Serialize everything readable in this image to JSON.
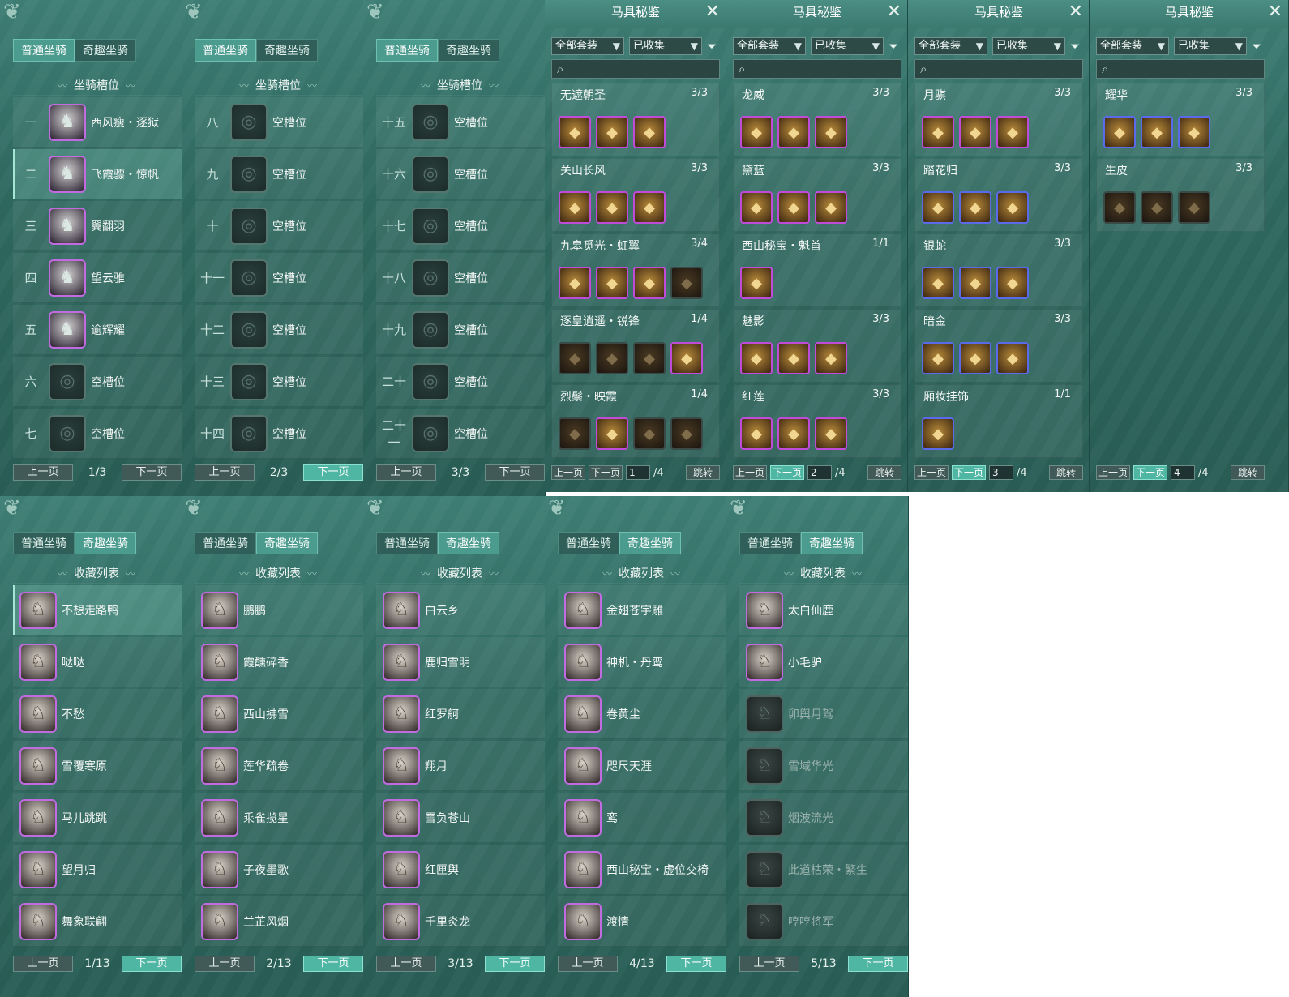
{
  "colors": {
    "panel_bg": "#2f6960",
    "tab_active": "#4b9c8e",
    "highlight_button": "#4fb6a4",
    "rarity_purple": "#c04bd8",
    "rarity_blue": "#5a6ae8"
  },
  "mount_tabs": [
    "普通坐骑",
    "奇趣坐骑"
  ],
  "slots_title": "坐骑槽位",
  "collection_title": "收藏列表",
  "prev_label": "上一页",
  "next_label": "下一页",
  "slot_panels": [
    {
      "page": "1/3",
      "slots": [
        {
          "num": "一",
          "name": "西风瘦・逐狱",
          "filled": true,
          "selected": false
        },
        {
          "num": "二",
          "name": "飞霞骠・惊帆",
          "filled": true,
          "selected": true
        },
        {
          "num": "三",
          "name": "翼翻羽",
          "filled": true,
          "selected": false
        },
        {
          "num": "四",
          "name": "望云骓",
          "filled": true,
          "selected": false
        },
        {
          "num": "五",
          "name": "逾辉耀",
          "filled": true,
          "selected": false
        },
        {
          "num": "六",
          "name": "空槽位",
          "filled": false,
          "selected": false
        },
        {
          "num": "七",
          "name": "空槽位",
          "filled": false,
          "selected": false
        }
      ]
    },
    {
      "page": "2/3",
      "slots": [
        {
          "num": "八",
          "name": "空槽位",
          "filled": false,
          "selected": false
        },
        {
          "num": "九",
          "name": "空槽位",
          "filled": false,
          "selected": false
        },
        {
          "num": "十",
          "name": "空槽位",
          "filled": false,
          "selected": false
        },
        {
          "num": "十一",
          "name": "空槽位",
          "filled": false,
          "selected": false
        },
        {
          "num": "十二",
          "name": "空槽位",
          "filled": false,
          "selected": false
        },
        {
          "num": "十三",
          "name": "空槽位",
          "filled": false,
          "selected": false
        },
        {
          "num": "十四",
          "name": "空槽位",
          "filled": false,
          "selected": false
        }
      ]
    },
    {
      "page": "3/3",
      "slots": [
        {
          "num": "十五",
          "name": "空槽位",
          "filled": false,
          "selected": false
        },
        {
          "num": "十六",
          "name": "空槽位",
          "filled": false,
          "selected": false
        },
        {
          "num": "十七",
          "name": "空槽位",
          "filled": false,
          "selected": false
        },
        {
          "num": "十八",
          "name": "空槽位",
          "filled": false,
          "selected": false
        },
        {
          "num": "十九",
          "name": "空槽位",
          "filled": false,
          "selected": false
        },
        {
          "num": "二十",
          "name": "空槽位",
          "filled": false,
          "selected": false
        },
        {
          "num": "二十一",
          "name": "空槽位",
          "filled": false,
          "selected": false
        }
      ]
    }
  ],
  "harness": {
    "title": "马具秘鉴",
    "filter_set": "全部套装",
    "filter_status": "已收集",
    "prev_short": "上一页",
    "next_short": "下一页",
    "total": "/4",
    "jump_label": "跳转",
    "pages": [
      {
        "page_input": "1",
        "sets": [
          {
            "name": "无遮朝圣",
            "count": "3/3",
            "items": [
              {
                "g": "◆"
              },
              {
                "g": "◆"
              },
              {
                "g": "◆"
              }
            ]
          },
          {
            "name": "关山长风",
            "count": "3/3",
            "items": [
              {
                "g": "◆"
              },
              {
                "g": "◆"
              },
              {
                "g": "◆"
              }
            ]
          },
          {
            "name": "九皋觅光・虹翼",
            "count": "3/4",
            "items": [
              {
                "g": "◆"
              },
              {
                "g": "◆"
              },
              {
                "g": "◆"
              },
              {
                "g": "◆",
                "dim": true
              }
            ]
          },
          {
            "name": "逐皇逍遥・锐锋",
            "count": "1/4",
            "items": [
              {
                "g": "◆",
                "dim": true
              },
              {
                "g": "◆",
                "dim": true
              },
              {
                "g": "◆",
                "dim": true
              },
              {
                "g": "◆"
              }
            ]
          },
          {
            "name": "烈鬃・映霞",
            "count": "1/4",
            "items": [
              {
                "g": "◆",
                "dim": true
              },
              {
                "g": "◆"
              },
              {
                "g": "◆",
                "dim": true
              },
              {
                "g": "◆",
                "dim": true
              }
            ]
          }
        ]
      },
      {
        "page_input": "2",
        "sets": [
          {
            "name": "龙威",
            "count": "3/3",
            "items": [
              {
                "g": "◆"
              },
              {
                "g": "◆"
              },
              {
                "g": "◆"
              }
            ]
          },
          {
            "name": "黛蓝",
            "count": "3/3",
            "items": [
              {
                "g": "◆"
              },
              {
                "g": "◆"
              },
              {
                "g": "◆"
              }
            ]
          },
          {
            "name": "西山秘宝・魁首",
            "count": "1/1",
            "items": [
              {
                "g": "◆"
              }
            ]
          },
          {
            "name": "魅影",
            "count": "3/3",
            "items": [
              {
                "g": "◆"
              },
              {
                "g": "◆"
              },
              {
                "g": "◆"
              }
            ]
          },
          {
            "name": "红莲",
            "count": "3/3",
            "items": [
              {
                "g": "◆"
              },
              {
                "g": "◆"
              },
              {
                "g": "◆"
              }
            ]
          }
        ]
      },
      {
        "page_input": "3",
        "sets": [
          {
            "name": "月骐",
            "count": "3/3",
            "items": [
              {
                "g": "◆"
              },
              {
                "g": "◆"
              },
              {
                "g": "◆"
              }
            ]
          },
          {
            "name": "踏花归",
            "count": "3/3",
            "items": [
              {
                "g": "◆",
                "blue": true
              },
              {
                "g": "◆",
                "blue": true
              },
              {
                "g": "◆",
                "blue": true
              }
            ]
          },
          {
            "name": "银蛇",
            "count": "3/3",
            "items": [
              {
                "g": "◆",
                "blue": true
              },
              {
                "g": "◆",
                "blue": true
              },
              {
                "g": "◆",
                "blue": true
              }
            ]
          },
          {
            "name": "暗金",
            "count": "3/3",
            "items": [
              {
                "g": "◆",
                "blue": true
              },
              {
                "g": "◆",
                "blue": true
              },
              {
                "g": "◆",
                "blue": true
              }
            ]
          },
          {
            "name": "厢妆挂饰",
            "count": "1/1",
            "items": [
              {
                "g": "◆",
                "blue": true
              }
            ]
          }
        ]
      },
      {
        "page_input": "4",
        "sets": [
          {
            "name": "耀华",
            "count": "3/3",
            "items": [
              {
                "g": "◆",
                "blue": true
              },
              {
                "g": "◆",
                "blue": true
              },
              {
                "g": "◆",
                "blue": true
              }
            ]
          },
          {
            "name": "生皮",
            "count": "3/3",
            "items": [
              {
                "g": "◆",
                "dim": true
              },
              {
                "g": "◆",
                "dim": true
              },
              {
                "g": "◆",
                "dim": true
              }
            ]
          }
        ]
      }
    ]
  },
  "collection_panels": [
    {
      "page": "1/13",
      "items": [
        {
          "name": "不想走路鸭",
          "dim": false,
          "selected": true
        },
        {
          "name": "哒哒",
          "dim": false
        },
        {
          "name": "不愁",
          "dim": false
        },
        {
          "name": "雪覆寒原",
          "dim": false
        },
        {
          "name": "马儿跳跳",
          "dim": false
        },
        {
          "name": "望月归",
          "dim": false
        },
        {
          "name": "舞象联翩",
          "dim": false
        }
      ]
    },
    {
      "page": "2/13",
      "items": [
        {
          "name": "鹏鹏",
          "dim": false
        },
        {
          "name": "霞醺碎香",
          "dim": false
        },
        {
          "name": "西山拂雪",
          "dim": false
        },
        {
          "name": "莲华疏卷",
          "dim": false
        },
        {
          "name": "乘雀揽星",
          "dim": false
        },
        {
          "name": "子夜墨歌",
          "dim": false
        },
        {
          "name": "兰芷风烟",
          "dim": false
        }
      ]
    },
    {
      "page": "3/13",
      "items": [
        {
          "name": "白云乡",
          "dim": false
        },
        {
          "name": "鹿归雪明",
          "dim": false
        },
        {
          "name": "红罗舸",
          "dim": false
        },
        {
          "name": "翔月",
          "dim": false
        },
        {
          "name": "雪负苍山",
          "dim": false
        },
        {
          "name": "红匣舆",
          "dim": false
        },
        {
          "name": "千里炎龙",
          "dim": false
        }
      ]
    },
    {
      "page": "4/13",
      "items": [
        {
          "name": "金翅苍宇雕",
          "dim": false
        },
        {
          "name": "神机・丹鸾",
          "dim": false
        },
        {
          "name": "卷黄尘",
          "dim": false
        },
        {
          "name": "咫尺天涯",
          "dim": false
        },
        {
          "name": "鸾",
          "dim": false
        },
        {
          "name": "西山秘宝・虚位交椅",
          "dim": false
        },
        {
          "name": "渡情",
          "dim": false
        }
      ]
    },
    {
      "page": "5/13",
      "items": [
        {
          "name": "太白仙鹿",
          "dim": false
        },
        {
          "name": "小毛驴",
          "dim": false
        },
        {
          "name": "卯舆月驾",
          "dim": true
        },
        {
          "name": "雪域华光",
          "dim": true
        },
        {
          "name": "烟波流光",
          "dim": true
        },
        {
          "name": "此道枯荣・繁生",
          "dim": true
        },
        {
          "name": "哼哼将军",
          "dim": true
        }
      ]
    }
  ]
}
